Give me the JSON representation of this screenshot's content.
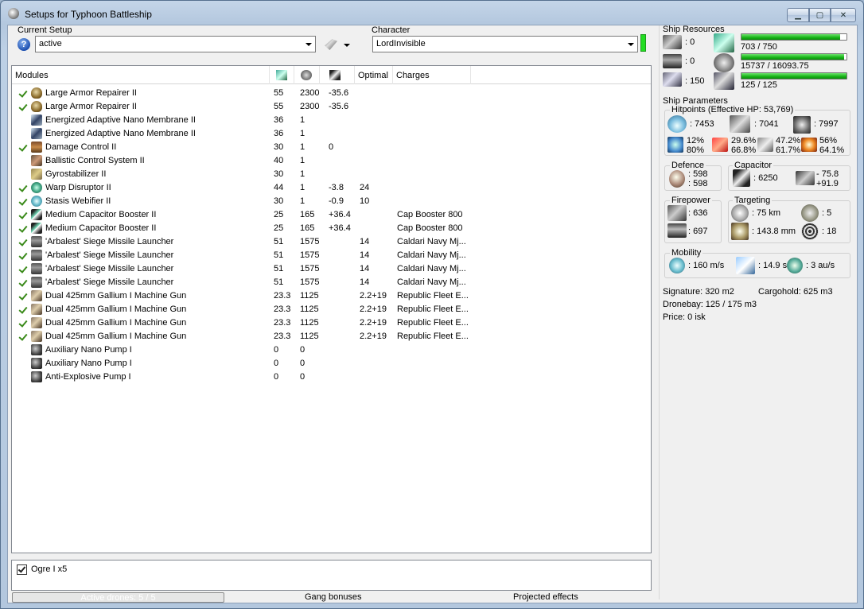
{
  "window": {
    "title": "Setups for Typhoon Battleship",
    "min": "▁",
    "max": "▢",
    "close": "✕"
  },
  "setup": {
    "label": "Current Setup",
    "value": "active"
  },
  "character": {
    "label": "Character",
    "value": "LordInvisible"
  },
  "modules": {
    "headers": {
      "name": "Modules",
      "optimal": "Optimal",
      "charges": "Charges"
    },
    "rows": [
      {
        "active": true,
        "icon": "armor-repairer-icon",
        "name": "Large Armor Repairer II",
        "cpu": "55",
        "pg": "2300",
        "cap": "-35.6",
        "optimal": "",
        "charges": ""
      },
      {
        "active": true,
        "icon": "armor-repairer-icon",
        "name": "Large Armor Repairer II",
        "cpu": "55",
        "pg": "2300",
        "cap": "-35.6",
        "optimal": "",
        "charges": ""
      },
      {
        "active": false,
        "icon": "nano-membrane-icon",
        "name": "Energized Adaptive Nano Membrane II",
        "cpu": "36",
        "pg": "1",
        "cap": "",
        "optimal": "",
        "charges": ""
      },
      {
        "active": false,
        "icon": "nano-membrane-icon",
        "name": "Energized Adaptive Nano Membrane II",
        "cpu": "36",
        "pg": "1",
        "cap": "",
        "optimal": "",
        "charges": ""
      },
      {
        "active": true,
        "icon": "damage-control-icon",
        "name": "Damage Control II",
        "cpu": "30",
        "pg": "1",
        "cap": "0",
        "optimal": "",
        "charges": ""
      },
      {
        "active": false,
        "icon": "ballistic-control-icon",
        "name": "Ballistic Control System II",
        "cpu": "40",
        "pg": "1",
        "cap": "",
        "optimal": "",
        "charges": ""
      },
      {
        "active": false,
        "icon": "gyrostabilizer-icon",
        "name": "Gyrostabilizer II",
        "cpu": "30",
        "pg": "1",
        "cap": "",
        "optimal": "",
        "charges": ""
      },
      {
        "active": true,
        "icon": "warp-disruptor-icon",
        "name": "Warp Disruptor II",
        "cpu": "44",
        "pg": "1",
        "cap": "-3.8",
        "optimal": "24",
        "charges": ""
      },
      {
        "active": true,
        "icon": "stasis-webifier-icon",
        "name": "Stasis Webifier II",
        "cpu": "30",
        "pg": "1",
        "cap": "-0.9",
        "optimal": "10",
        "charges": ""
      },
      {
        "active": true,
        "icon": "cap-booster-icon",
        "name": "Medium Capacitor Booster II",
        "cpu": "25",
        "pg": "165",
        "cap": "+36.4",
        "optimal": "",
        "charges": "Cap Booster 800"
      },
      {
        "active": true,
        "icon": "cap-booster-icon",
        "name": "Medium Capacitor Booster II",
        "cpu": "25",
        "pg": "165",
        "cap": "+36.4",
        "optimal": "",
        "charges": "Cap Booster 800"
      },
      {
        "active": true,
        "icon": "missile-launcher-icon",
        "name": "'Arbalest' Siege Missile Launcher",
        "cpu": "51",
        "pg": "1575",
        "cap": "",
        "optimal": "14",
        "charges": "Caldari Navy Mj..."
      },
      {
        "active": true,
        "icon": "missile-launcher-icon",
        "name": "'Arbalest' Siege Missile Launcher",
        "cpu": "51",
        "pg": "1575",
        "cap": "",
        "optimal": "14",
        "charges": "Caldari Navy Mj..."
      },
      {
        "active": true,
        "icon": "missile-launcher-icon",
        "name": "'Arbalest' Siege Missile Launcher",
        "cpu": "51",
        "pg": "1575",
        "cap": "",
        "optimal": "14",
        "charges": "Caldari Navy Mj..."
      },
      {
        "active": true,
        "icon": "missile-launcher-icon",
        "name": "'Arbalest' Siege Missile Launcher",
        "cpu": "51",
        "pg": "1575",
        "cap": "",
        "optimal": "14",
        "charges": "Caldari Navy Mj..."
      },
      {
        "active": true,
        "icon": "machine-gun-icon",
        "name": "Dual 425mm Gallium I Machine Gun",
        "cpu": "23.3",
        "pg": "1125",
        "cap": "",
        "optimal": "2.2+19",
        "charges": "Republic Fleet E..."
      },
      {
        "active": true,
        "icon": "machine-gun-icon",
        "name": "Dual 425mm Gallium I Machine Gun",
        "cpu": "23.3",
        "pg": "1125",
        "cap": "",
        "optimal": "2.2+19",
        "charges": "Republic Fleet E..."
      },
      {
        "active": true,
        "icon": "machine-gun-icon",
        "name": "Dual 425mm Gallium I Machine Gun",
        "cpu": "23.3",
        "pg": "1125",
        "cap": "",
        "optimal": "2.2+19",
        "charges": "Republic Fleet E..."
      },
      {
        "active": true,
        "icon": "machine-gun-icon",
        "name": "Dual 425mm Gallium I Machine Gun",
        "cpu": "23.3",
        "pg": "1125",
        "cap": "",
        "optimal": "2.2+19",
        "charges": "Republic Fleet E..."
      },
      {
        "active": false,
        "icon": "rig-icon",
        "name": "Auxiliary Nano Pump I",
        "cpu": "0",
        "pg": "0",
        "cap": "",
        "optimal": "",
        "charges": ""
      },
      {
        "active": false,
        "icon": "rig-icon",
        "name": "Auxiliary Nano Pump I",
        "cpu": "0",
        "pg": "0",
        "cap": "",
        "optimal": "",
        "charges": ""
      },
      {
        "active": false,
        "icon": "rig-icon",
        "name": "Anti-Explosive Pump I",
        "cpu": "0",
        "pg": "0",
        "cap": "",
        "optimal": "",
        "charges": ""
      }
    ]
  },
  "drones": {
    "item": "Ogre I x5",
    "checked": true
  },
  "bottom_tabs": {
    "active_drones": "Active drones: 5 / 5",
    "gang": "Gang bonuses",
    "projected": "Projected effects"
  },
  "resources": {
    "title": "Ship Resources",
    "turret": ": 0",
    "launcher": ": 0",
    "calibration": ": 150",
    "cpu": {
      "text": "703 / 750",
      "fraction": 0.937
    },
    "power": {
      "text": "15737 / 16093.75",
      "fraction": 0.978
    },
    "drone_bw": {
      "text": "125 / 125",
      "fraction": 1.0
    }
  },
  "params": {
    "title": "Ship Parameters",
    "hitpoints": {
      "title": "Hitpoints (Effective HP: 53,769)",
      "shield": ": 7453",
      "armor": ": 7041",
      "hull": ": 7997",
      "em": [
        "12%",
        "80%"
      ],
      "thermal": [
        "29.6%",
        "66.8%"
      ],
      "kinetic": [
        "47.2%",
        "61.7%"
      ],
      "explosive": [
        "56%",
        "64.1%"
      ]
    },
    "defence": {
      "title": "Defence",
      "a": ": 598",
      "b": ": 598"
    },
    "capacitor": {
      "title": "Capacitor",
      "capacity": ": 6250",
      "delta_a": "- 75.8",
      "delta_b": "+91.9"
    },
    "firepower": {
      "title": "Firepower",
      "turret": ": 636",
      "missile": ": 697"
    },
    "targeting": {
      "title": "Targeting",
      "range": ": 75 km",
      "targets": ": 5",
      "scan": ": 143.8 mm",
      "sensor": ": 18"
    },
    "mobility": {
      "title": "Mobility",
      "speed": ": 160 m/s",
      "align": ": 14.9 s",
      "warp": ": 3 au/s"
    },
    "signature": "Signature: 320 m2",
    "cargohold": "Cargohold: 625 m3",
    "dronebay": "Dronebay: 125 / 175 m3",
    "price": "Price: 0 isk"
  }
}
